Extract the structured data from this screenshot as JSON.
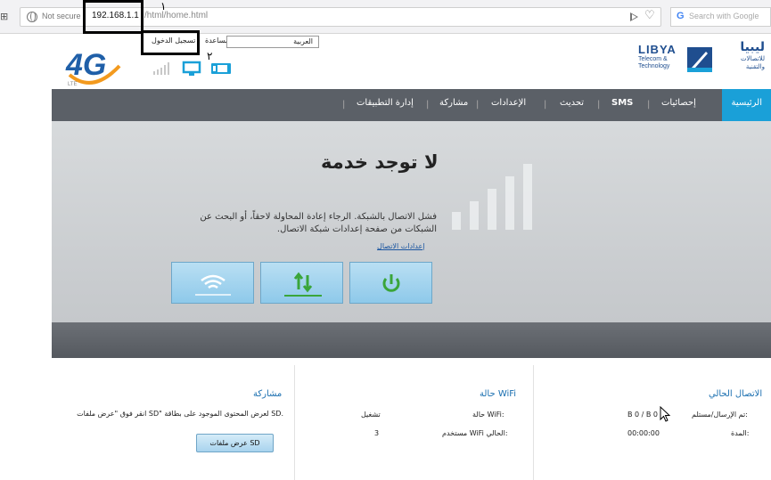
{
  "browser": {
    "security_label": "Not secure",
    "url_host": "192.168.1.1",
    "url_path": "/html/home.html",
    "search_placeholder": "Search with Google"
  },
  "annotations": {
    "label_1": "١",
    "label_2": "٢"
  },
  "header": {
    "logo_text": "4G",
    "logo_sub": "LTE",
    "login_label": "تسجيل الدخول",
    "help_label": "مساعدة",
    "language_value": "العربية",
    "brand_en": "LIBYA",
    "brand_en_sub1": "Telecom &",
    "brand_en_sub2": "Technology",
    "brand_ar": "ليبيا",
    "brand_ar_sub1": "للاتصالات",
    "brand_ar_sub2": "والتقنية"
  },
  "nav": {
    "items": [
      {
        "label": "الرئيسية"
      },
      {
        "label": "إحصائيات"
      },
      {
        "label": "SMS"
      },
      {
        "label": "تحديث"
      },
      {
        "label": "الإعدادات"
      },
      {
        "label": "مشاركة"
      },
      {
        "label": "إدارة التطبيقات"
      }
    ]
  },
  "status": {
    "title": "لا توجد خدمة",
    "message": "فشل الاتصال بالشبكة. الرجاء إعادة المحاولة لاحقاً، أو البحث عن الشبكات من صفحة إعدادات شبكة الاتصال.",
    "settings_link": "إعدادات الاتصال"
  },
  "sections": {
    "connection": {
      "title": "الاتصال الحالي",
      "sent_recv_label": "تم الإرسال/مستلم:",
      "sent_recv_value": "B 0 / B 0",
      "duration_label": "المدة:",
      "duration_value": "00:00:00"
    },
    "wifi": {
      "title": "حالة WiFi",
      "status_label": "حالة WiFi:",
      "status_value": "تشغيل",
      "users_label": "مستخدم WiFi الحالي:",
      "users_value": "3"
    },
    "share": {
      "title": "مشاركة",
      "description": "انقر فوق \"عرض ملفات SD\" لعرض المحتوى الموجود على بطاقة SD.",
      "button_label": "عرض ملفات SD"
    }
  },
  "colors": {
    "nav_bg": "#5b6067",
    "nav_active": "#1aa0d8",
    "brand_blue": "#1f4e8f",
    "accent_orange": "#f39a1e",
    "section_title": "#1a6fb0"
  }
}
